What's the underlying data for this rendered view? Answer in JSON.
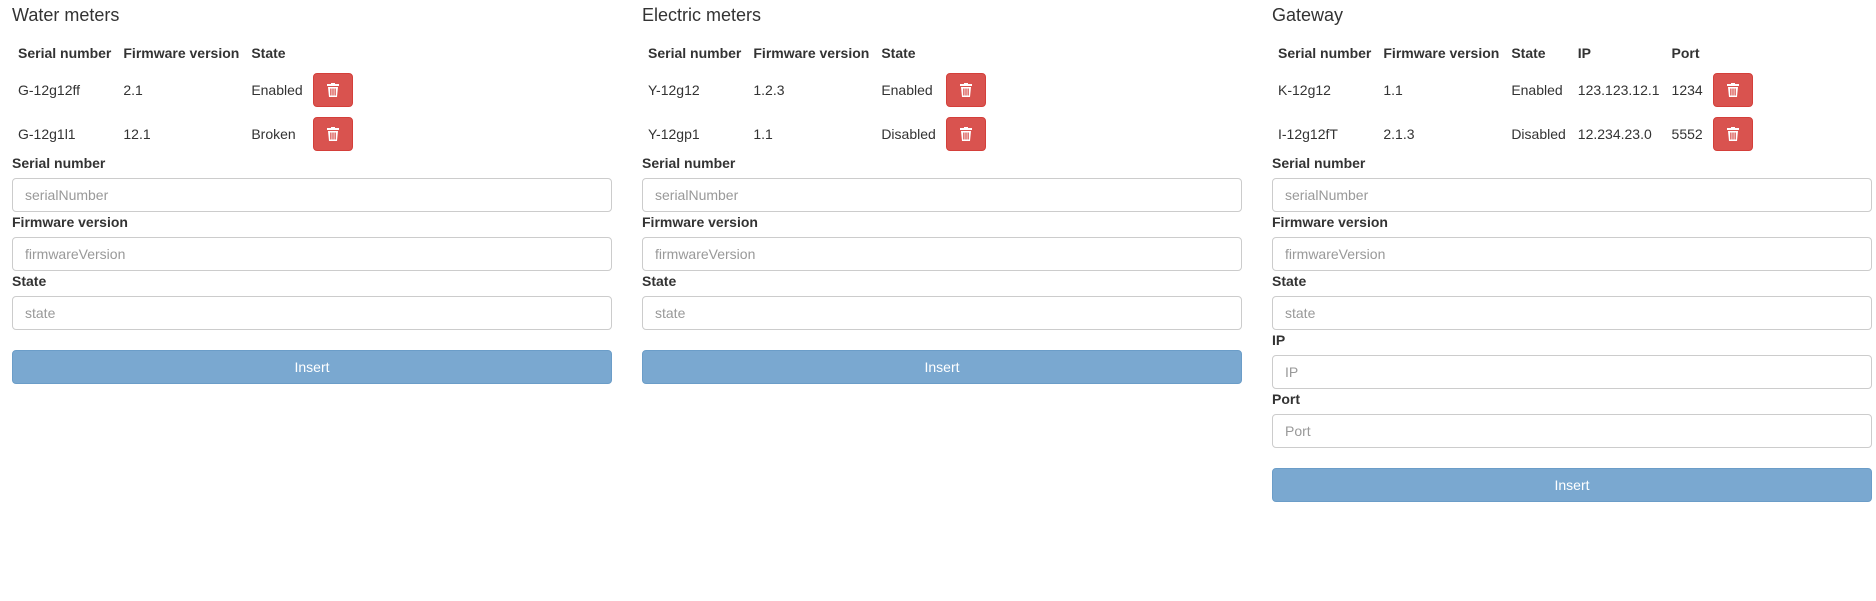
{
  "water": {
    "title": "Water meters",
    "headers": [
      "Serial number",
      "Firmware version",
      "State"
    ],
    "rows": [
      {
        "serial": "G-12g12ff",
        "firmware": "2.1",
        "state": "Enabled"
      },
      {
        "serial": "G-12g1l1",
        "firmware": "12.1",
        "state": "Broken"
      }
    ],
    "form": {
      "serial_label": "Serial number",
      "serial_placeholder": "serialNumber",
      "firmware_label": "Firmware version",
      "firmware_placeholder": "firmwareVersion",
      "state_label": "State",
      "state_placeholder": "state",
      "insert_label": "Insert"
    }
  },
  "electric": {
    "title": "Electric meters",
    "headers": [
      "Serial number",
      "Firmware version",
      "State"
    ],
    "rows": [
      {
        "serial": "Y-12g12",
        "firmware": "1.2.3",
        "state": "Enabled"
      },
      {
        "serial": "Y-12gp1",
        "firmware": "1.1",
        "state": "Disabled"
      }
    ],
    "form": {
      "serial_label": "Serial number",
      "serial_placeholder": "serialNumber",
      "firmware_label": "Firmware version",
      "firmware_placeholder": "firmwareVersion",
      "state_label": "State",
      "state_placeholder": "state",
      "insert_label": "Insert"
    }
  },
  "gateway": {
    "title": "Gateway",
    "headers": [
      "Serial number",
      "Firmware version",
      "State",
      "IP",
      "Port"
    ],
    "rows": [
      {
        "serial": "K-12g12",
        "firmware": "1.1",
        "state": "Enabled",
        "ip": "123.123.12.1",
        "port": "1234"
      },
      {
        "serial": "I-12g12fT",
        "firmware": "2.1.3",
        "state": "Disabled",
        "ip": "12.234.23.0",
        "port": "5552"
      }
    ],
    "form": {
      "serial_label": "Serial number",
      "serial_placeholder": "serialNumber",
      "firmware_label": "Firmware version",
      "firmware_placeholder": "firmwareVersion",
      "state_label": "State",
      "state_placeholder": "state",
      "ip_label": "IP",
      "ip_placeholder": "IP",
      "port_label": "Port",
      "port_placeholder": "Port",
      "insert_label": "Insert"
    }
  },
  "icons": {
    "delete": "trash-icon"
  },
  "colors": {
    "delete_button": "#d9534f",
    "insert_button": "#7aa8d0"
  }
}
